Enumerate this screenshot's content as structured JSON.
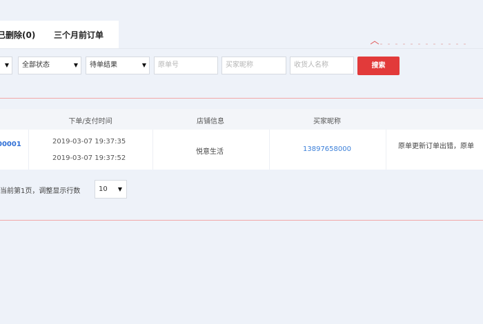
{
  "tabs": {
    "deleted": "已删除(0)",
    "three_months": "三个月前订单"
  },
  "filters": {
    "partial_select": "",
    "status_select": "全部状态",
    "logistics_select": "待单结果",
    "order_no_placeholder": "原单号",
    "buyer_nick_placeholder": "买家昵称",
    "receiver_placeholder": "收货人名称",
    "search_label": "搜索",
    "dropdown_icon": "▼"
  },
  "table": {
    "headers": {
      "time": "下单/支付时间",
      "shop": "店铺信息",
      "buyer": "买家昵称"
    },
    "rows": [
      {
        "order_no": "00001",
        "order_time": "2019-03-07 19:37:35",
        "pay_time": "2019-03-07 19:37:52",
        "shop": "悦意生活",
        "buyer": "13897658000",
        "remark": "原单更新订单出错，原单"
      }
    ]
  },
  "pagination": {
    "text": "当前第1页，调整显示行数",
    "page_size": "10"
  },
  "colors": {
    "accent": "#e23a3a",
    "link": "#3b7fd9",
    "background": "#eef2f9"
  }
}
